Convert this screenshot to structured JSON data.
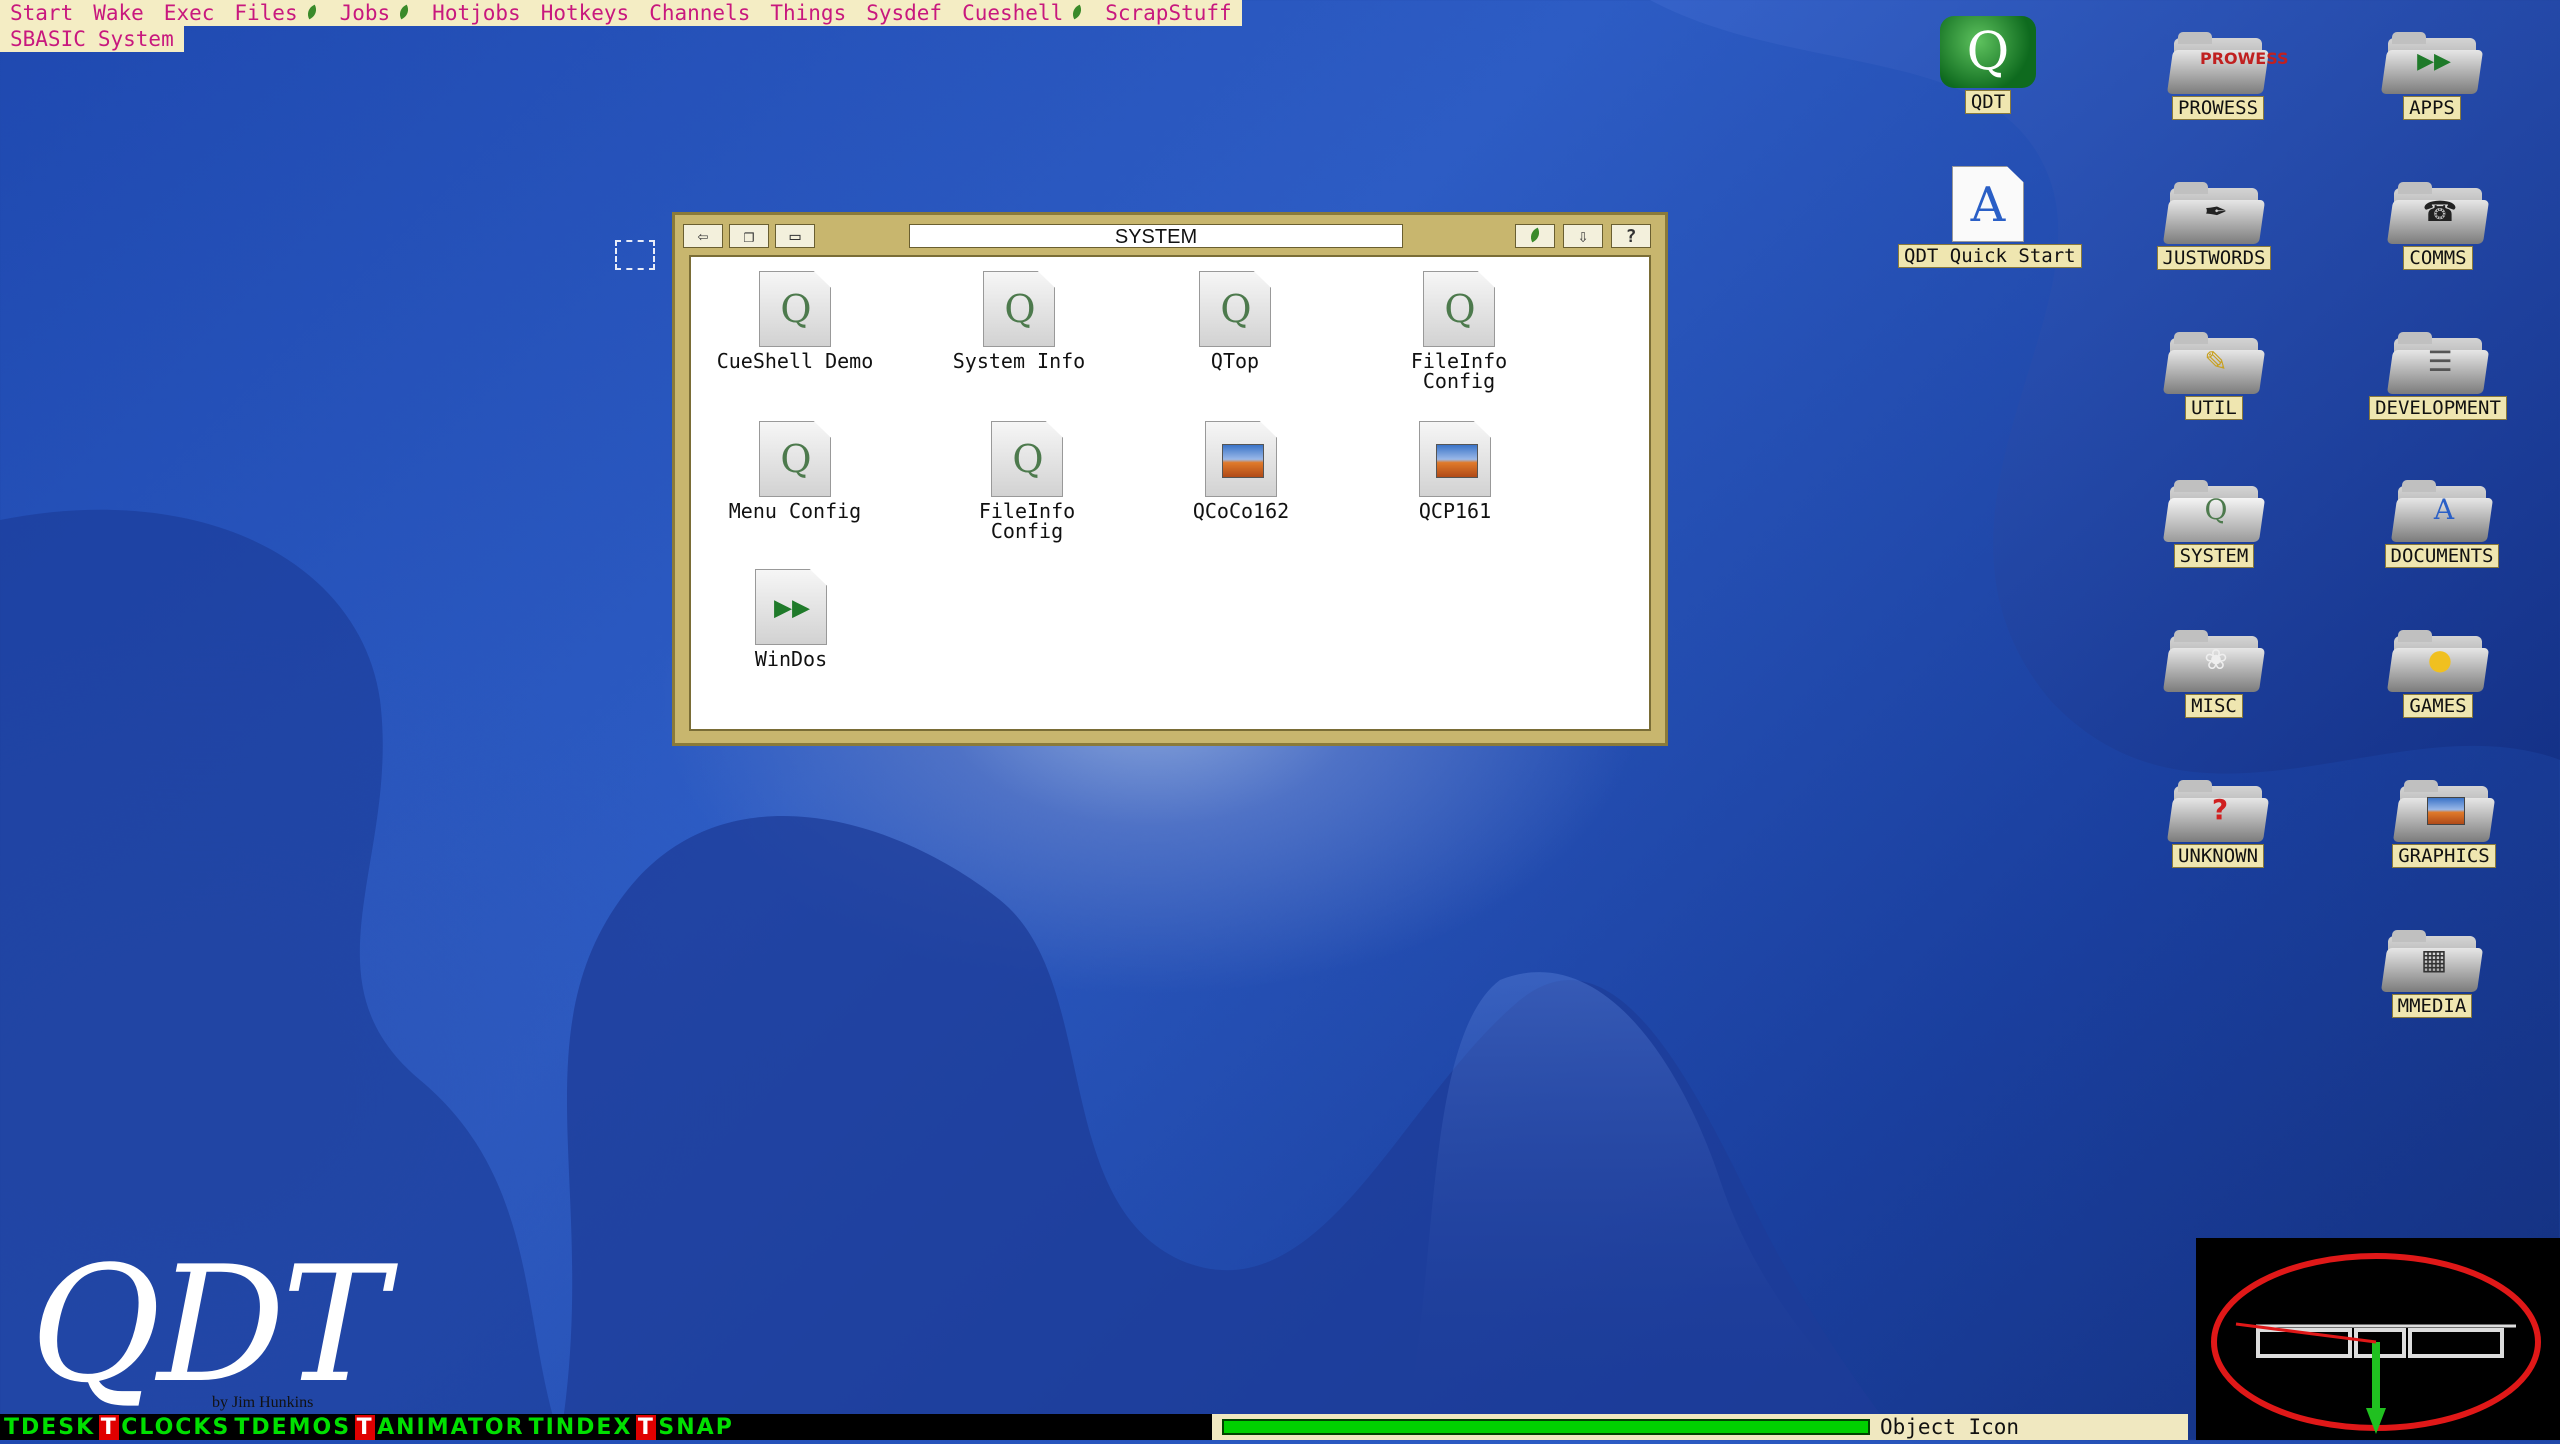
{
  "menubar": {
    "items": [
      {
        "label": "Start"
      },
      {
        "label": "Wake"
      },
      {
        "label": "Exec"
      },
      {
        "label": "Files"
      },
      {
        "label": "Jobs"
      },
      {
        "label": "Hotjobs"
      },
      {
        "label": "Hotkeys"
      },
      {
        "label": "Channels"
      },
      {
        "label": "Things"
      },
      {
        "label": "Sysdef"
      },
      {
        "label": "Cueshell"
      },
      {
        "label": "ScrapStuff"
      }
    ],
    "row2": [
      {
        "label": "SBASIC"
      },
      {
        "label": "System"
      }
    ]
  },
  "window": {
    "title": "SYSTEM",
    "files": [
      {
        "label": "CueShell Demo",
        "icon": "q-doc"
      },
      {
        "label": "System Info",
        "icon": "q-doc"
      },
      {
        "label": "QTop",
        "icon": "q-doc"
      },
      {
        "label": "FileInfo\nConfig",
        "icon": "q-doc"
      },
      {
        "label": "Menu Config",
        "icon": "q-doc"
      },
      {
        "label": "FileInfo\nConfig",
        "icon": "q-doc"
      },
      {
        "label": "QCoCo162",
        "icon": "image-doc"
      },
      {
        "label": "QCP161",
        "icon": "image-doc"
      },
      {
        "label": "WinDos",
        "icon": "fast-forward-doc"
      }
    ]
  },
  "desktop": {
    "icons": [
      {
        "label": "QDT",
        "icon": "qdt-app-icon"
      },
      {
        "label": "PROWESS",
        "icon": "folder-icon"
      },
      {
        "label": "APPS",
        "icon": "folder-icon"
      },
      {
        "label": "QDT Quick Start",
        "icon": "document-icon"
      },
      {
        "label": "JUSTWORDS",
        "icon": "folder-icon"
      },
      {
        "label": "COMMS",
        "icon": "folder-icon"
      },
      {
        "label": "UTIL",
        "icon": "folder-icon"
      },
      {
        "label": "DEVELOPMENT",
        "icon": "folder-icon"
      },
      {
        "label": "SYSTEM",
        "icon": "folder-icon"
      },
      {
        "label": "DOCUMENTS",
        "icon": "folder-icon"
      },
      {
        "label": "MISC",
        "icon": "folder-icon"
      },
      {
        "label": "GAMES",
        "icon": "folder-icon"
      },
      {
        "label": "UNKNOWN",
        "icon": "folder-icon"
      },
      {
        "label": "GRAPHICS",
        "icon": "folder-icon"
      },
      {
        "label": "MMEDIA",
        "icon": "folder-icon"
      }
    ]
  },
  "logo": {
    "text": "QDT",
    "byline": "by Jim Hunkins"
  },
  "taskbar": {
    "items": [
      {
        "label": "TDESK"
      },
      {
        "label": "CLOCKS",
        "flag": "T"
      },
      {
        "label": "TDEMOS"
      },
      {
        "label": "ANIMATOR",
        "flag": "T"
      },
      {
        "label": "TINDEX"
      },
      {
        "label": "SNAP",
        "flag": "T"
      }
    ]
  },
  "status": {
    "text": "Object Icon"
  },
  "colors": {
    "menu_text": "#c8187e",
    "menu_bg": "#f4edc4",
    "window_frame": "#c8b66e",
    "taskbar_text": "#00e000",
    "progress": "#00d000"
  }
}
